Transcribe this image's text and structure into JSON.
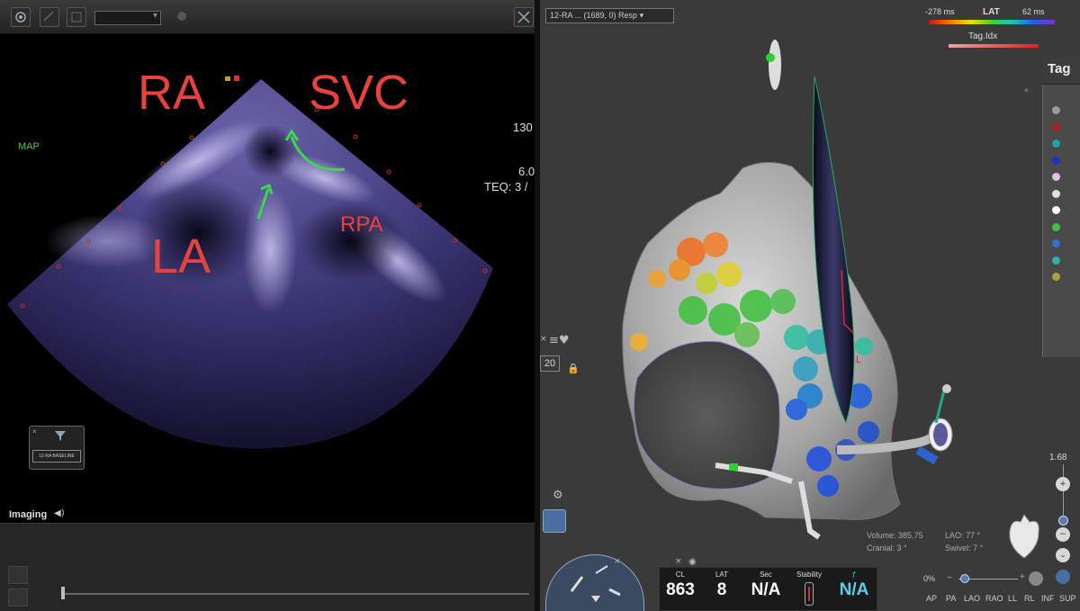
{
  "echo": {
    "labels": {
      "ra": "RA",
      "svc": "SVC",
      "la": "LA",
      "rpa": "RPA"
    },
    "map_label": "MAP",
    "side_values": {
      "depth": "130",
      "scale": "6.0",
      "teq": "TEQ: 3 /"
    },
    "thumbnail_label": "12-RA BASELINE",
    "imaging_label": "Imaging"
  },
  "map3d": {
    "map_selector": "12-RA ... (1689, 0) Resp",
    "lat_legend": {
      "min": "-278 ms",
      "title": "LAT",
      "max": "62 ms",
      "tag_label": "Tag.Idx"
    },
    "tag_panel_title": "Tag",
    "tag_colors": [
      "#9a9a9a",
      "#b02020",
      "#20a0a0",
      "#2030c0",
      "#e0c0e0",
      "#e0e0e0",
      "#ffffff",
      "#40c040",
      "#3070d0",
      "#30b0b0",
      "#b0a040"
    ],
    "points_value": "20",
    "volume": {
      "label": "Volume",
      "value": "385.75"
    },
    "lao": {
      "label": "LAO",
      "value": "77 °"
    },
    "cranial": {
      "label": "Cranial",
      "value": "3 °"
    },
    "swivel": {
      "label": "Swivel",
      "value": "7 °"
    },
    "zoom_value": "1.68",
    "zoom_percent": "0%",
    "views": [
      "AP",
      "PA",
      "LAO",
      "RAO",
      "LL",
      "RL",
      "INF",
      "SUP"
    ],
    "catheter_letter": "L"
  },
  "stats_panel": {
    "cl": {
      "label": "CL",
      "value": "863"
    },
    "lat": {
      "label": "LAT",
      "value": "8"
    },
    "sec": {
      "label": "Sec",
      "value": "N/A"
    },
    "stability": {
      "label": "Stability"
    },
    "extra": {
      "value": "N/A"
    }
  },
  "colors": {
    "annotation_red": "#e8423f",
    "annotation_green": "#3fd64a",
    "echo_tint": "#9a90d8"
  }
}
